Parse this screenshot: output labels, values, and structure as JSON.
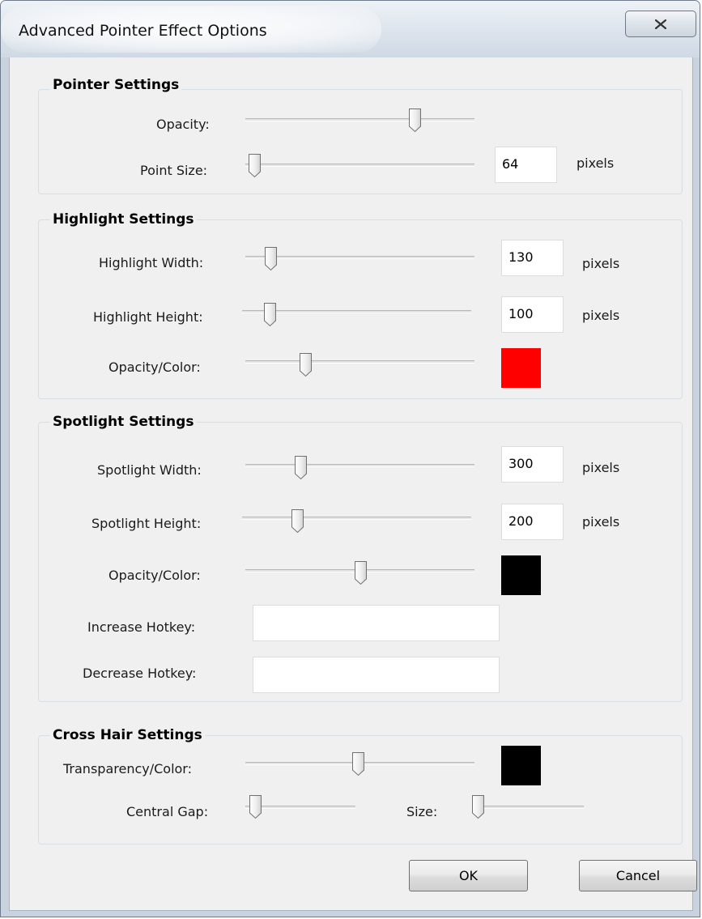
{
  "window": {
    "title": "Advanced Pointer Effect Options",
    "close_icon": "close-x-icon"
  },
  "pointer": {
    "title": "Pointer Settings",
    "opacity_label": "Opacity:",
    "opacity_value": 0.74,
    "point_size_label": "Point Size:",
    "point_size_slider": 0.04,
    "point_size_value": "64",
    "point_size_unit": "pixels"
  },
  "highlight": {
    "title": "Highlight Settings",
    "width_label": "Highlight Width:",
    "width_slider": 0.11,
    "width_value": "130",
    "width_unit": "pixels",
    "height_label": "Highlight Height:",
    "height_slider": 0.12,
    "height_value": "100",
    "height_unit": "pixels",
    "opacity_label": "Opacity/Color:",
    "opacity_slider": 0.26,
    "color": "#ff0000"
  },
  "spotlight": {
    "title": "Spotlight Settings",
    "width_label": "Spotlight Width:",
    "width_slider": 0.24,
    "width_value": "300",
    "width_unit": "pixels",
    "height_label": "Spotlight Height:",
    "height_slider": 0.24,
    "height_value": "200",
    "height_unit": "pixels",
    "opacity_label": "Opacity/Color:",
    "opacity_slider": 0.5,
    "color": "#000000",
    "increase_label": "Increase Hotkey:",
    "increase_value": "",
    "decrease_label": "Decrease Hotkey:",
    "decrease_value": ""
  },
  "crosshair": {
    "title": "Cross Hair Settings",
    "transparency_label": "Transparency/Color:",
    "transparency_slider": 0.49,
    "color": "#000000",
    "gap_label": "Central Gap:",
    "gap_slider": 0.02,
    "size_label": "Size:",
    "size_slider": 0.02
  },
  "buttons": {
    "ok": "OK",
    "cancel": "Cancel"
  }
}
